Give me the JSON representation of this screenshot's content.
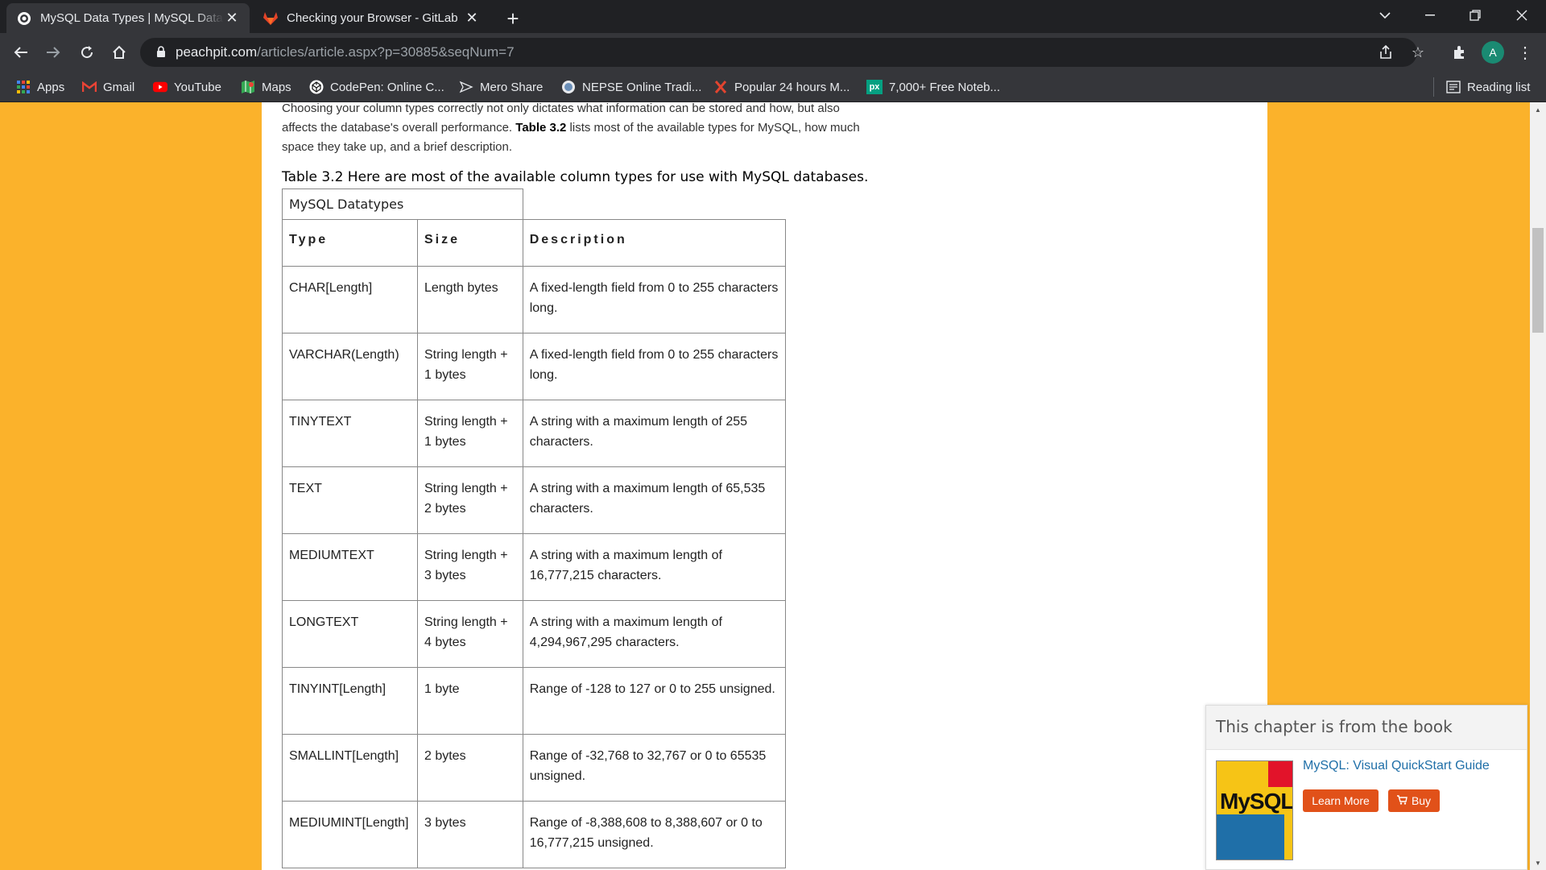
{
  "tabs": [
    {
      "title": "MySQL Data Types | MySQL Data Types | Peachpit",
      "active": true
    },
    {
      "title": "Checking your Browser - GitLab",
      "active": false
    }
  ],
  "address": {
    "host": "peachpit.com",
    "path": "/articles/article.aspx?p=30885&seqNum=7"
  },
  "profile_initial": "A",
  "bookmarks": [
    {
      "label": "Apps",
      "icon": "apps-grid-icon"
    },
    {
      "label": "Gmail",
      "icon": "gmail-icon"
    },
    {
      "label": "YouTube",
      "icon": "youtube-icon"
    },
    {
      "label": "Maps",
      "icon": "maps-icon"
    },
    {
      "label": "CodePen: Online C...",
      "icon": "codepen-icon"
    },
    {
      "label": "Mero Share",
      "icon": "mero-share-icon"
    },
    {
      "label": "NEPSE Online Tradi...",
      "icon": "globe-icon"
    },
    {
      "label": "Popular 24 hours M...",
      "icon": "x-logo-icon"
    },
    {
      "label": "7,000+ Free Noteb...",
      "icon": "px-logo-icon"
    }
  ],
  "reading_list": "Reading list",
  "article": {
    "intro_before": "Choosing your column types correctly not only dictates what information can be stored and how, but also affects the database's overall performance. ",
    "intro_bold": "Table 3.2",
    "intro_after": " lists most of the available types for MySQL, how much space they take up, and a brief description.",
    "table_caption": "Table 3.2 Here are most of the available column types for use with MySQL databases."
  },
  "table": {
    "caption": "MySQL Datatypes",
    "headers": [
      "Type",
      "Size",
      "Description"
    ],
    "rows": [
      [
        "CHAR[Length]",
        "Length bytes",
        "A fixed-length field from 0 to 255 characters long."
      ],
      [
        "VARCHAR(Length)",
        "String length + 1 bytes",
        "A fixed-length field from 0 to 255 characters long."
      ],
      [
        "TINYTEXT",
        "String length + 1 bytes",
        "A string with a maximum length of 255 characters."
      ],
      [
        "TEXT",
        "String length + 2 bytes",
        "A string with a maximum length of 65,535 characters."
      ],
      [
        "MEDIUMTEXT",
        "String length + 3 bytes",
        "A string with a maximum length of 16,777,215 characters."
      ],
      [
        "LONGTEXT",
        "String length + 4 bytes",
        "A string with a maximum length of 4,294,967,295 characters."
      ],
      [
        "TINYINT[Length]",
        "1 byte",
        "Range of -128 to 127 or 0 to 255 unsigned."
      ],
      [
        "SMALLINT[Length]",
        "2 bytes",
        "Range of -32,768 to 32,767 or 0 to 65535 unsigned."
      ],
      [
        "MEDIUMINT[Length]",
        "3 bytes",
        "Range of -8,388,608 to 8,388,607 or 0 to 16,777,215 unsigned."
      ]
    ]
  },
  "promo": {
    "heading": "This chapter is from the book",
    "book_title": "MySQL: Visual QuickStart Guide",
    "cover_text": "MySQL",
    "learn_more": "Learn More",
    "buy": "Buy"
  },
  "colors": {
    "page_bg": "#fbb22b",
    "link": "#1f6fa8",
    "button": "#e15119"
  }
}
